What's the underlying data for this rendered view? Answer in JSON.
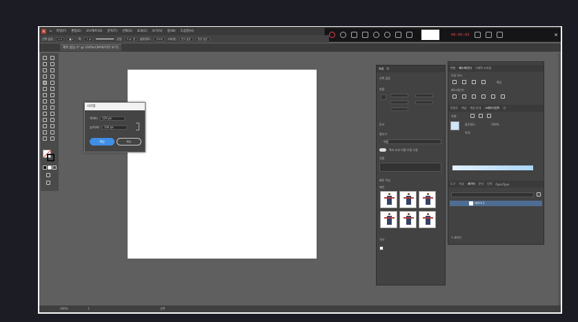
{
  "app": {
    "logo": "Ai",
    "menu": [
      "파일(F)",
      "편집(E)",
      "오브젝트(O)",
      "문자(T)",
      "선택(S)",
      "효과(C)",
      "보기(V)",
      "창(W)",
      "도움말(H)"
    ]
  },
  "control_bar": {
    "selection_label": "선택 없음",
    "stroke_label": "획:",
    "stroke_value": "1 pt",
    "stroke_style": "균등",
    "brush_label": "5 pt. 원",
    "opacity_label": "불투명도:",
    "opacity_value": "100%",
    "style_label": "스타일:",
    "doc_setup_label": "문서 설정",
    "prefs_label": "환경 설정"
  },
  "document_tab": {
    "label": "제목 없음-1* @ 100%(CMYK/미리 보기)"
  },
  "recorder": {
    "time": "00:00:03"
  },
  "dialog": {
    "title": "사각형",
    "width_label": "폭(W):",
    "width_value": "120 px",
    "height_label": "높이(H):",
    "height_value": "120 px",
    "ok_label": "확인",
    "cancel_label": "취소"
  },
  "properties_panel": {
    "tabs": [
      "속성",
      "레"
    ],
    "no_selection": "선택 없음",
    "transform_label": "변환",
    "artboard_label": "문서",
    "units_value": "픽셀",
    "scale_label": "획과 효과 비율 조절 사용",
    "align_label": "정렬",
    "edit_label": "펼치기",
    "grid_label": "빠른 작업",
    "pattern_label": "패턴",
    "swatch_label": "격자"
  },
  "right_panel": {
    "top_tabs": [
      "변형",
      "패스파인더",
      "그래픽 스타일"
    ],
    "shape_modes_label": "모양 모드:",
    "pathfinder_label": "패스파인더:",
    "expand_label": "확장",
    "mid_tabs": [
      "투명도",
      "색상",
      "색상 안내",
      "그레이디언트",
      "선"
    ],
    "gradient_type_label": "유형:",
    "gradient_opacity_label": "불투명도:",
    "gradient_opacity_value": "100%",
    "gradient_location_label": "위치:",
    "bottom_tabs": [
      "도구",
      "속성",
      "레이어",
      "문자",
      "단락",
      "OpenType"
    ],
    "layer_name": "레이어 1",
    "layer_count": "1 레이어"
  },
  "status_bar": {
    "zoom": "100%",
    "artboard_num": "1",
    "mode": "선택"
  }
}
